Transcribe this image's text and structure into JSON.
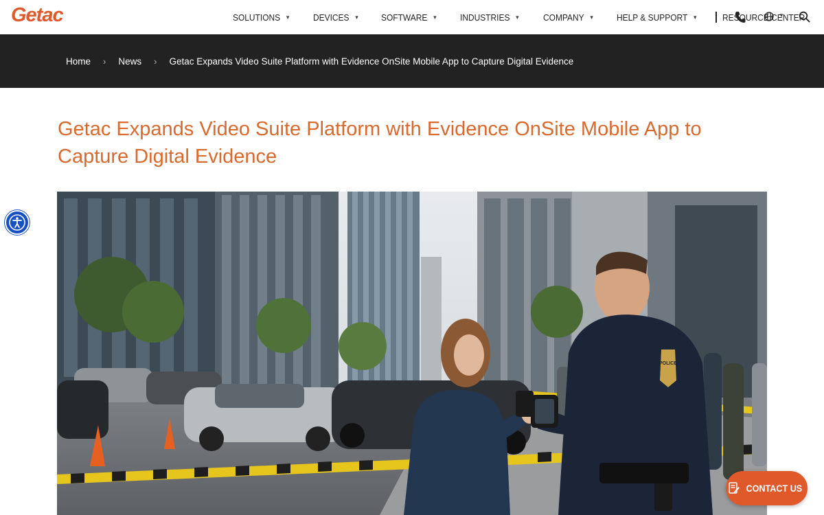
{
  "brand": {
    "logo_text": "Getac",
    "accent": "#e0592b",
    "title_color": "#d9692d"
  },
  "nav": {
    "items": [
      {
        "label": "SOLUTIONS",
        "has_dropdown": true
      },
      {
        "label": "DEVICES",
        "has_dropdown": true
      },
      {
        "label": "SOFTWARE",
        "has_dropdown": true
      },
      {
        "label": "INDUSTRIES",
        "has_dropdown": true
      },
      {
        "label": "COMPANY",
        "has_dropdown": true
      },
      {
        "label": "HELP & SUPPORT",
        "has_dropdown": true
      },
      {
        "label": "RESOURCE CENTER",
        "has_dropdown": false
      }
    ],
    "icons": [
      "phone-icon",
      "globe-icon",
      "search-icon"
    ]
  },
  "breadcrumb": {
    "home": "Home",
    "news": "News",
    "current": "Getac Expands Video Suite Platform with Evidence OnSite Mobile App to Capture Digital Evidence"
  },
  "article": {
    "title": "Getac Expands Video Suite Platform with Evidence OnSite Mobile App to Capture Digital Evidence"
  },
  "hero": {
    "badge_text": "POLICE"
  },
  "contact": {
    "label": "CONTACT US"
  }
}
